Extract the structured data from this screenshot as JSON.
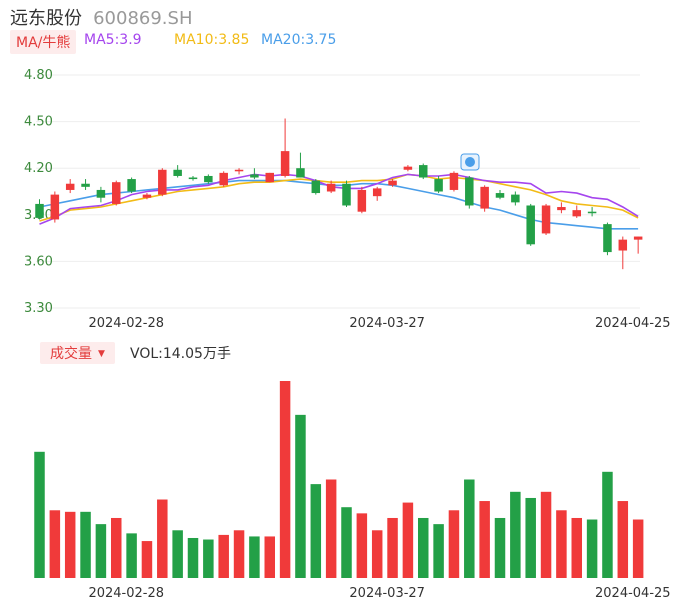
{
  "stock": {
    "name": "远东股份",
    "code": "600869.SH"
  },
  "ma": {
    "toggle_label": "MA/牛熊",
    "ma5": "MA5:3.9",
    "ma10": "MA10:3.85",
    "ma20": "MA20:3.75",
    "colors": {
      "ma5": "#a545ee",
      "ma10": "#f2bb16",
      "ma20": "#4a9ee9"
    }
  },
  "volume": {
    "toggle_label": "成交量",
    "text": "VOL:14.05万手"
  },
  "colors": {
    "up": "#f03a3a",
    "down": "#23a047",
    "grid": "#eeeeee",
    "axis_text": "#3d8a3d"
  },
  "chart_data": {
    "type": "candlestick",
    "ylim": [
      3.3,
      4.8
    ],
    "yticks": [
      "4.80",
      "4.50",
      "4.20",
      "3.90",
      "3.60",
      "3.30"
    ],
    "xticks": [
      "2024-02-28",
      "2024-03-27",
      "2024-04-25"
    ],
    "xtick_index": [
      5,
      22,
      38
    ],
    "candles": [
      {
        "o": 3.97,
        "c": 3.88,
        "h": 4.0,
        "l": 3.87
      },
      {
        "o": 3.87,
        "c": 4.03,
        "h": 4.05,
        "l": 3.85
      },
      {
        "o": 4.06,
        "c": 4.1,
        "h": 4.13,
        "l": 4.04
      },
      {
        "o": 4.1,
        "c": 4.08,
        "h": 4.13,
        "l": 4.06
      },
      {
        "o": 4.06,
        "c": 4.01,
        "h": 4.08,
        "l": 3.98
      },
      {
        "o": 3.97,
        "c": 4.11,
        "h": 4.12,
        "l": 3.96
      },
      {
        "o": 4.13,
        "c": 4.05,
        "h": 4.14,
        "l": 4.04
      },
      {
        "o": 4.01,
        "c": 4.03,
        "h": 4.04,
        "l": 4.0
      },
      {
        "o": 4.03,
        "c": 4.19,
        "h": 4.2,
        "l": 4.02
      },
      {
        "o": 4.19,
        "c": 4.15,
        "h": 4.22,
        "l": 4.14
      },
      {
        "o": 4.14,
        "c": 4.13,
        "h": 4.15,
        "l": 4.12
      },
      {
        "o": 4.15,
        "c": 4.11,
        "h": 4.16,
        "l": 4.1
      },
      {
        "o": 4.09,
        "c": 4.17,
        "h": 4.18,
        "l": 4.08
      },
      {
        "o": 4.18,
        "c": 4.19,
        "h": 4.2,
        "l": 4.16
      },
      {
        "o": 4.16,
        "c": 4.14,
        "h": 4.2,
        "l": 4.13
      },
      {
        "o": 4.11,
        "c": 4.17,
        "h": 4.17,
        "l": 4.11
      },
      {
        "o": 4.15,
        "c": 4.31,
        "h": 4.52,
        "l": 4.14
      },
      {
        "o": 4.2,
        "c": 4.14,
        "h": 4.3,
        "l": 4.14
      },
      {
        "o": 4.12,
        "c": 4.04,
        "h": 4.13,
        "l": 4.03
      },
      {
        "o": 4.05,
        "c": 4.1,
        "h": 4.12,
        "l": 4.04
      },
      {
        "o": 4.1,
        "c": 3.96,
        "h": 4.12,
        "l": 3.95
      },
      {
        "o": 3.92,
        "c": 4.06,
        "h": 4.08,
        "l": 3.91
      },
      {
        "o": 4.02,
        "c": 4.07,
        "h": 4.08,
        "l": 3.99
      },
      {
        "o": 4.09,
        "c": 4.12,
        "h": 4.13,
        "l": 4.08
      },
      {
        "o": 4.19,
        "c": 4.21,
        "h": 4.22,
        "l": 4.18
      },
      {
        "o": 4.22,
        "c": 4.14,
        "h": 4.23,
        "l": 4.13
      },
      {
        "o": 4.13,
        "c": 4.05,
        "h": 4.15,
        "l": 4.04
      },
      {
        "o": 4.06,
        "c": 4.17,
        "h": 4.18,
        "l": 4.05
      },
      {
        "o": 4.14,
        "c": 3.96,
        "h": 4.15,
        "l": 3.94
      },
      {
        "o": 3.94,
        "c": 4.08,
        "h": 4.09,
        "l": 3.92
      },
      {
        "o": 4.04,
        "c": 4.01,
        "h": 4.06,
        "l": 4.0
      },
      {
        "o": 4.03,
        "c": 3.98,
        "h": 4.05,
        "l": 3.96
      },
      {
        "o": 3.96,
        "c": 3.71,
        "h": 3.97,
        "l": 3.7
      },
      {
        "o": 3.78,
        "c": 3.96,
        "h": 3.97,
        "l": 3.77
      },
      {
        "o": 3.93,
        "c": 3.95,
        "h": 3.98,
        "l": 3.91
      },
      {
        "o": 3.89,
        "c": 3.93,
        "h": 3.96,
        "l": 3.88
      },
      {
        "o": 3.92,
        "c": 3.91,
        "h": 3.95,
        "l": 3.89
      },
      {
        "o": 3.84,
        "c": 3.66,
        "h": 3.85,
        "l": 3.64
      },
      {
        "o": 3.67,
        "c": 3.74,
        "h": 3.76,
        "l": 3.55
      },
      {
        "o": 3.74,
        "c": 3.76,
        "h": 3.76,
        "l": 3.65
      }
    ],
    "ma5": [
      3.84,
      3.88,
      3.94,
      3.95,
      3.96,
      3.99,
      4.03,
      4.05,
      4.06,
      4.06,
      4.08,
      4.09,
      4.12,
      4.14,
      4.16,
      4.15,
      4.16,
      4.15,
      4.12,
      4.08,
      4.07,
      4.07,
      4.1,
      4.14,
      4.16,
      4.15,
      4.15,
      4.16,
      4.14,
      4.12,
      4.11,
      4.11,
      4.1,
      4.04,
      4.05,
      4.04,
      4.01,
      4.0,
      3.95,
      3.89
    ],
    "ma10": [
      3.86,
      3.89,
      3.93,
      3.94,
      3.95,
      3.97,
      3.99,
      4.01,
      4.03,
      4.05,
      4.06,
      4.07,
      4.08,
      4.1,
      4.11,
      4.11,
      4.12,
      4.13,
      4.12,
      4.11,
      4.11,
      4.12,
      4.12,
      4.13,
      4.16,
      4.15,
      4.13,
      4.14,
      4.13,
      4.12,
      4.1,
      4.08,
      4.06,
      4.03,
      3.99,
      3.97,
      3.96,
      3.95,
      3.93,
      3.88
    ],
    "ma20": [
      3.95,
      3.97,
      3.99,
      4.01,
      4.03,
      4.04,
      4.05,
      4.06,
      4.07,
      4.08,
      4.09,
      4.1,
      4.11,
      4.12,
      4.12,
      4.12,
      4.12,
      4.11,
      4.1,
      4.09,
      4.09,
      4.1,
      4.1,
      4.09,
      4.07,
      4.05,
      4.03,
      4.01,
      3.98,
      3.95,
      3.93,
      3.9,
      3.87,
      3.85,
      3.84,
      3.83,
      3.82,
      3.81,
      3.81,
      3.81
    ],
    "volumes": [
      8.2,
      4.4,
      4.3,
      4.3,
      3.5,
      3.9,
      2.9,
      2.4,
      5.1,
      3.1,
      2.6,
      2.5,
      2.8,
      3.1,
      2.7,
      2.7,
      12.8,
      10.6,
      6.1,
      6.4,
      4.6,
      4.2,
      3.1,
      3.9,
      4.9,
      3.9,
      3.5,
      4.4,
      6.4,
      5.0,
      3.9,
      5.6,
      5.2,
      5.6,
      4.4,
      3.9,
      3.8,
      6.9,
      5.0,
      3.8
    ]
  }
}
